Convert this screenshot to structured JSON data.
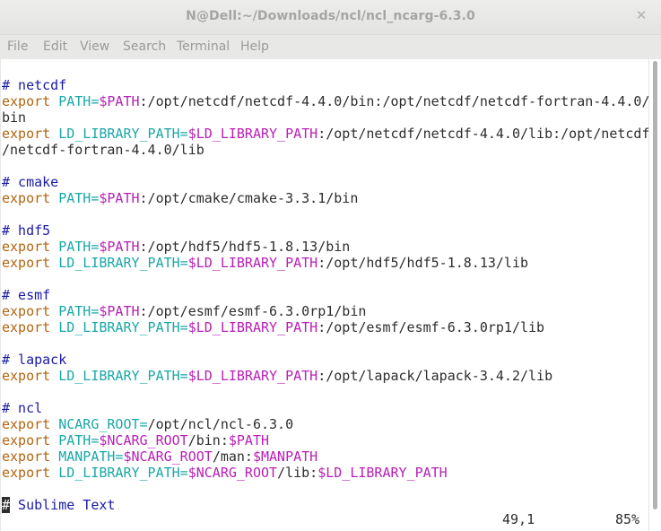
{
  "window": {
    "title": "N@Dell:~/Downloads/ncl/ncl_ncarg-6.3.0",
    "close_glyph": "✕"
  },
  "menubar": {
    "items": [
      "File",
      "Edit",
      "View",
      "Search",
      "Terminal",
      "Help"
    ]
  },
  "colors": {
    "comment": "#1a1aa6",
    "keyword": "#b3640e",
    "var_name": "#1aa7a7",
    "var_ref": "#b820b5",
    "text": "#2d2d2d"
  },
  "lines": [
    [
      [
        "cm",
        "# netcdf"
      ]
    ],
    [
      [
        "kw",
        "export"
      ],
      [
        "tx",
        " "
      ],
      [
        "vn",
        "PATH="
      ],
      [
        "vr",
        "$PATH"
      ],
      [
        "tx",
        ":/opt/netcdf/netcdf-4.4.0/bin:/opt/netcdf/netcdf-fortran-4.4.0/"
      ]
    ],
    [
      [
        "tx",
        "bin"
      ]
    ],
    [
      [
        "kw",
        "export"
      ],
      [
        "tx",
        " "
      ],
      [
        "vn",
        "LD_LIBRARY_PATH="
      ],
      [
        "vr",
        "$LD_LIBRARY_PATH"
      ],
      [
        "tx",
        ":/opt/netcdf/netcdf-4.4.0/lib:/opt/netcdf"
      ]
    ],
    [
      [
        "tx",
        "/netcdf-fortran-4.4.0/lib"
      ]
    ],
    [],
    [
      [
        "cm",
        "# cmake"
      ]
    ],
    [
      [
        "kw",
        "export"
      ],
      [
        "tx",
        " "
      ],
      [
        "vn",
        "PATH="
      ],
      [
        "vr",
        "$PATH"
      ],
      [
        "tx",
        ":/opt/cmake/cmake-3.3.1/bin"
      ]
    ],
    [],
    [
      [
        "cm",
        "# hdf5"
      ]
    ],
    [
      [
        "kw",
        "export"
      ],
      [
        "tx",
        " "
      ],
      [
        "vn",
        "PATH="
      ],
      [
        "vr",
        "$PATH"
      ],
      [
        "tx",
        ":/opt/hdf5/hdf5-1.8.13/bin"
      ]
    ],
    [
      [
        "kw",
        "export"
      ],
      [
        "tx",
        " "
      ],
      [
        "vn",
        "LD_LIBRARY_PATH="
      ],
      [
        "vr",
        "$LD_LIBRARY_PATH"
      ],
      [
        "tx",
        ":/opt/hdf5/hdf5-1.8.13/lib"
      ]
    ],
    [],
    [
      [
        "cm",
        "# esmf"
      ]
    ],
    [
      [
        "kw",
        "export"
      ],
      [
        "tx",
        " "
      ],
      [
        "vn",
        "PATH="
      ],
      [
        "vr",
        "$PATH"
      ],
      [
        "tx",
        ":/opt/esmf/esmf-6.3.0rp1/bin"
      ]
    ],
    [
      [
        "kw",
        "export"
      ],
      [
        "tx",
        " "
      ],
      [
        "vn",
        "LD_LIBRARY_PATH="
      ],
      [
        "vr",
        "$LD_LIBRARY_PATH"
      ],
      [
        "tx",
        ":/opt/esmf/esmf-6.3.0rp1/lib"
      ]
    ],
    [],
    [
      [
        "cm",
        "# lapack"
      ]
    ],
    [
      [
        "kw",
        "export"
      ],
      [
        "tx",
        " "
      ],
      [
        "vn",
        "LD_LIBRARY_PATH="
      ],
      [
        "vr",
        "$LD_LIBRARY_PATH"
      ],
      [
        "tx",
        ":/opt/lapack/lapack-3.4.2/lib"
      ]
    ],
    [],
    [
      [
        "cm",
        "# ncl"
      ]
    ],
    [
      [
        "kw",
        "export"
      ],
      [
        "tx",
        " "
      ],
      [
        "vn",
        "NCARG_ROOT="
      ],
      [
        "tx",
        "/opt/ncl/ncl-6.3.0"
      ]
    ],
    [
      [
        "kw",
        "export"
      ],
      [
        "tx",
        " "
      ],
      [
        "vn",
        "PATH="
      ],
      [
        "vr",
        "$NCARG_ROOT"
      ],
      [
        "tx",
        "/bin:"
      ],
      [
        "vr",
        "$PATH"
      ]
    ],
    [
      [
        "kw",
        "export"
      ],
      [
        "tx",
        " "
      ],
      [
        "vn",
        "MANPATH="
      ],
      [
        "vr",
        "$NCARG_ROOT"
      ],
      [
        "tx",
        "/man:"
      ],
      [
        "vr",
        "$MANPATH"
      ]
    ],
    [
      [
        "kw",
        "export"
      ],
      [
        "tx",
        " "
      ],
      [
        "vn",
        "LD_LIBRARY_PATH="
      ],
      [
        "vr",
        "$NCARG_ROOT"
      ],
      [
        "tx",
        "/lib:"
      ],
      [
        "vr",
        "$LD_LIBRARY_PATH"
      ]
    ],
    [],
    [
      [
        "cursor",
        "#"
      ],
      [
        "cm",
        " Sublime Text"
      ]
    ]
  ],
  "status": {
    "position": "49,1",
    "percent": "85%"
  }
}
